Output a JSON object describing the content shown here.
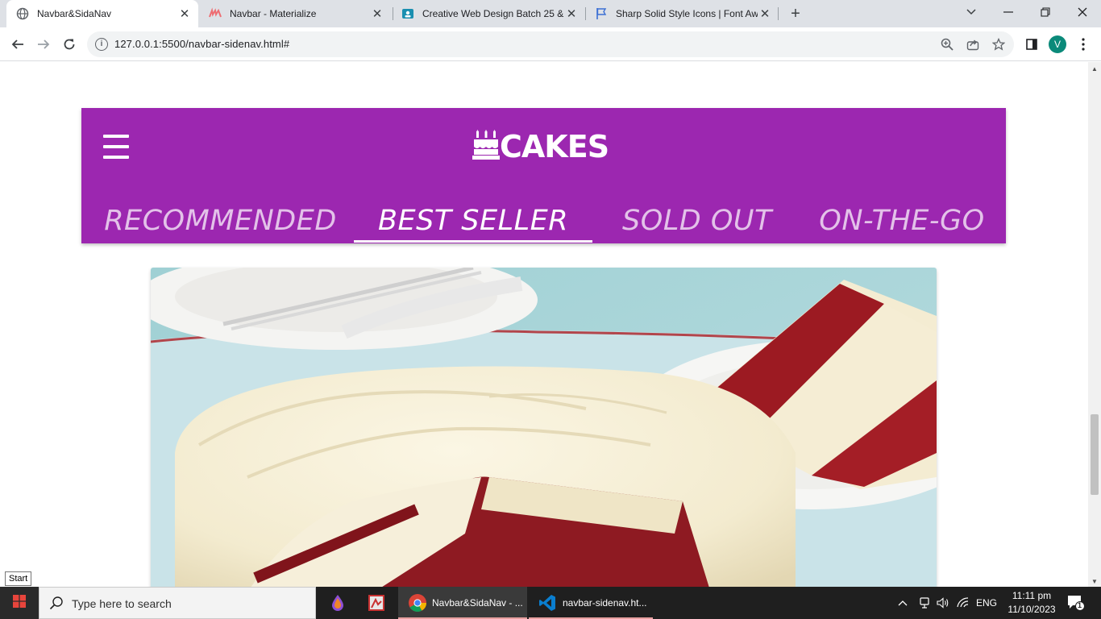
{
  "browser": {
    "tabs": [
      {
        "title": "Navbar&SidaNav",
        "active": true
      },
      {
        "title": "Navbar - Materialize",
        "active": false
      },
      {
        "title": "Creative Web Design Batch 25 &",
        "active": false
      },
      {
        "title": "Sharp Solid Style Icons | Font Aw",
        "active": false
      }
    ],
    "url": "127.0.0.1:5500/navbar-sidenav.html#",
    "profile_initial": "V"
  },
  "page": {
    "brand": "CAKES",
    "nav_tabs": [
      {
        "label": "RECOMMENDED",
        "active": false
      },
      {
        "label": "BEST SELLER",
        "active": true
      },
      {
        "label": "SOLD OUT",
        "active": false
      },
      {
        "label": "ON-THE-GO",
        "active": false
      }
    ],
    "image_description": "red velvet cake with cream cheese frosting"
  },
  "colors": {
    "navbar": "#9c27b0",
    "accent_red": "#a01c24"
  },
  "taskbar": {
    "start_tooltip": "Start",
    "search_placeholder": "Type here to search",
    "apps": [
      {
        "label": "Navbar&SidaNav - ...",
        "active": true
      },
      {
        "label": "navbar-sidenav.ht...",
        "active": false
      }
    ],
    "language": "ENG",
    "time": "11:11 pm",
    "date": "11/10/2023",
    "notification_count": "1"
  }
}
